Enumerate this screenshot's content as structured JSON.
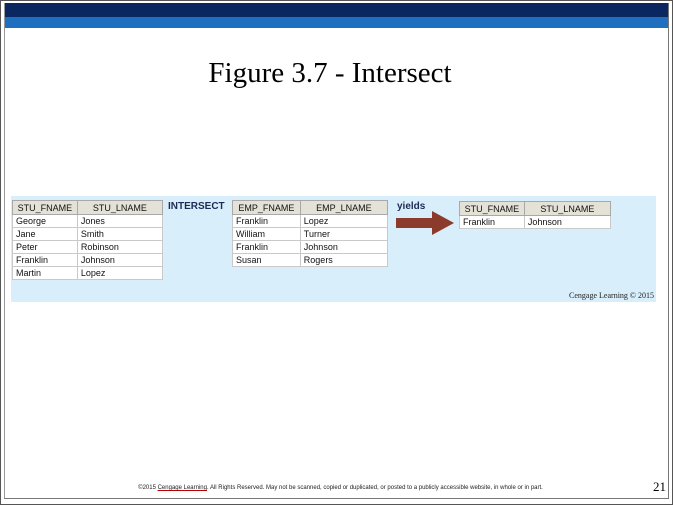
{
  "slide": {
    "title": "Figure 3.7 - Intersect",
    "page_number": "21",
    "credit": "Cengage Learning © 2015",
    "footer_prefix": "©2015 ",
    "footer_brand": "Cengage Learning",
    "footer_suffix": ". All Rights Reserved. May not be scanned, copied or duplicated, or posted to a publicly accessible website, in whole or in part."
  },
  "operators": {
    "intersect": "INTERSECT",
    "yields": "yields"
  },
  "colors": {
    "top_bar": "#0a2760",
    "accent_bar": "#1f6fc0",
    "panel": "#d8eefa",
    "arrow": "#8b3a2c"
  },
  "table_students": {
    "headers": [
      "STU_FNAME",
      "STU_LNAME"
    ],
    "rows": [
      [
        "George",
        "Jones"
      ],
      [
        "Jane",
        "Smith"
      ],
      [
        "Peter",
        "Robinson"
      ],
      [
        "Franklin",
        "Johnson"
      ],
      [
        "Martin",
        "Lopez"
      ]
    ]
  },
  "table_employees": {
    "headers": [
      "EMP_FNAME",
      "EMP_LNAME"
    ],
    "rows": [
      [
        "Franklin",
        "Lopez"
      ],
      [
        "William",
        "Turner"
      ],
      [
        "Franklin",
        "Johnson"
      ],
      [
        "Susan",
        "Rogers"
      ]
    ]
  },
  "table_result": {
    "headers": [
      "STU_FNAME",
      "STU_LNAME"
    ],
    "rows": [
      [
        "Franklin",
        "Johnson"
      ]
    ]
  }
}
